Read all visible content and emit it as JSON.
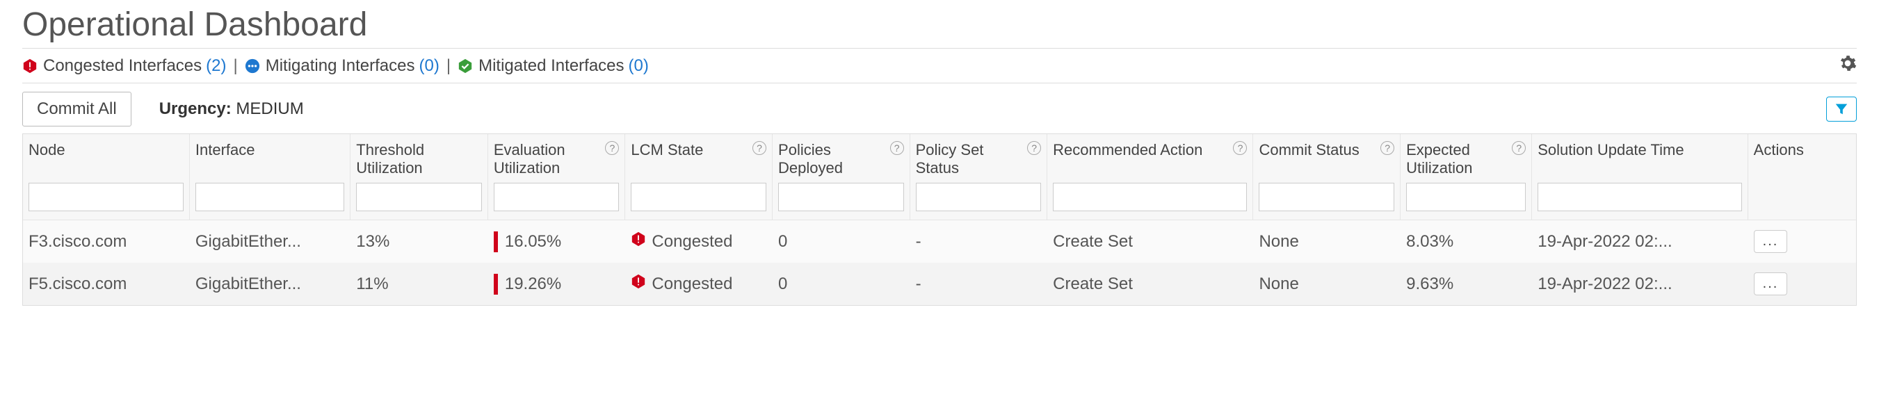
{
  "title": "Operational Dashboard",
  "status": {
    "congested_label": "Congested Interfaces",
    "congested_count": "(2)",
    "mitigating_label": "Mitigating Interfaces",
    "mitigating_count": "(0)",
    "mitigated_label": "Mitigated Interfaces",
    "mitigated_count": "(0)"
  },
  "controls": {
    "commit_all": "Commit All",
    "urgency_label": "Urgency:",
    "urgency_value": "MEDIUM"
  },
  "columns": {
    "node": "Node",
    "interface": "Interface",
    "threshold": "Threshold Utilization",
    "evaluation": "Evaluation Utilization",
    "lcm": "LCM State",
    "policies": "Policies Deployed",
    "policyset": "Policy Set Status",
    "recaction": "Recommended Action",
    "commit": "Commit Status",
    "expected": "Expected Utilization",
    "solution": "Solution Update Time",
    "actions": "Actions"
  },
  "rows": [
    {
      "node": "F3.cisco.com",
      "interface": "GigabitEther...",
      "threshold": "13%",
      "evaluation": "16.05%",
      "lcm": "Congested",
      "policies": "0",
      "policyset": "-",
      "recaction": "Create Set",
      "commit": "None",
      "expected": "8.03%",
      "solution": "19-Apr-2022 02:..."
    },
    {
      "node": "F5.cisco.com",
      "interface": "GigabitEther...",
      "threshold": "11%",
      "evaluation": "19.26%",
      "lcm": "Congested",
      "policies": "0",
      "policyset": "-",
      "recaction": "Create Set",
      "commit": "None",
      "expected": "9.63%",
      "solution": "19-Apr-2022 02:..."
    }
  ],
  "action_btn_label": "..."
}
